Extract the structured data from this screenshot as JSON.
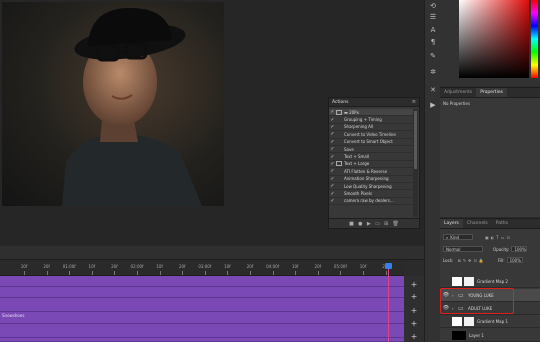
{
  "actions": {
    "title": "Actions",
    "set_name": "20Px",
    "items": [
      "Grouping + Timing",
      "Sharpening All",
      "Convert to Video Timeline",
      "Convert to Smart Object",
      "Save",
      "Text + Small",
      "Text + Large",
      "ATI Flatten & Reverse",
      "Animation Sharpening",
      "Low Quality Sharpening",
      "Smooth Pixels",
      "camera raw by dealers..."
    ]
  },
  "properties": {
    "tabs": [
      "Adjustments",
      "Properties"
    ],
    "active_tab": "Properties",
    "status": "No Properties"
  },
  "layers": {
    "tabs": [
      "Layers",
      "Channels",
      "Paths"
    ],
    "filter_kind": "Kind",
    "blend_mode": "Normal",
    "opacity_label": "Opacity:",
    "opacity_value": "100%",
    "lock_label": "Lock:",
    "fill_label": "Fill:",
    "fill_value": "100%",
    "items": [
      {
        "name": "Gradient Map 2",
        "type": "adjustment"
      },
      {
        "name": "YOUNG LUKE",
        "type": "group"
      },
      {
        "name": "ADULT LUKE",
        "type": "group"
      },
      {
        "name": "Gradient Map 1",
        "type": "adjustment"
      },
      {
        "name": "Layer 1",
        "type": "pixel"
      }
    ]
  },
  "timeline": {
    "ticks": [
      "10f",
      "20f",
      "01:00f",
      "10f",
      "20f",
      "02:00f",
      "10f",
      "20f",
      "03:00f",
      "10f",
      "20f",
      "04:00f",
      "10f",
      "20f",
      "05:00f",
      "10f",
      "20f"
    ],
    "tracks": [
      {
        "label": ""
      },
      {
        "label": ""
      },
      {
        "label": ""
      },
      {
        "label": "Snowshoes"
      },
      {
        "label": ""
      },
      {
        "label": ""
      }
    ]
  },
  "colors": {
    "track_purple": "#7b49b6",
    "playhead": "#e0428a",
    "annotation_red": "#e02020"
  }
}
